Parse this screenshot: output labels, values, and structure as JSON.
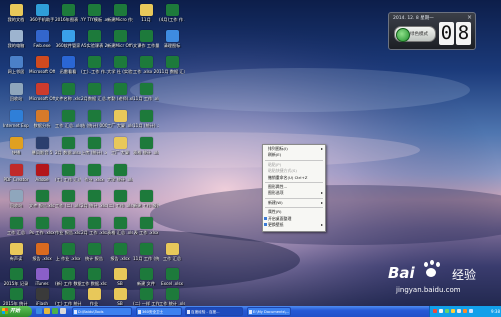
{
  "desktop": {
    "icons": [
      {
        "label": "我的文档",
        "color": "#e8c85a",
        "col": 0,
        "row": 0
      },
      {
        "label": "360手机助手",
        "color": "#2f9ed8",
        "col": 1,
        "row": 0
      },
      {
        "label": "2016年图表 ..xlsx",
        "color": "#1d7a3b",
        "col": 2,
        "row": 0
      },
      {
        "label": "YY TIY模板 .xlsx",
        "color": "#1d7a3b",
        "col": 3,
        "row": 0
      },
      {
        "label": "新建Micro 作业 .xlsx",
        "color": "#1d7a3b",
        "col": 4,
        "row": 0
      },
      {
        "label": "11月",
        "color": "#e8c85a",
        "col": 5,
        "row": 0
      },
      {
        "label": "(4月)工作 作 .xlsx",
        "color": "#1d7a3b",
        "col": 6,
        "row": 0
      },
      {
        "label": "我的电脑",
        "color": "#9db4cf",
        "col": 0,
        "row": 1
      },
      {
        "label": "Fwb.exe",
        "color": "#3366cc",
        "col": 1,
        "row": 1
      },
      {
        "label": "360软件管家",
        "color": "#3aa0e8",
        "col": 2,
        "row": 1
      },
      {
        "label": "A5实验课表 2016.xlsx",
        "color": "#1d7a3b",
        "col": 3,
        "row": 1
      },
      {
        "label": "新建Micr Office..",
        "color": "#1d7a3b",
        "col": 4,
        "row": 1
      },
      {
        "label": "文课作 工作量 .xlsx",
        "color": "#1d7a3b",
        "col": 5,
        "row": 1
      },
      {
        "label": "清理图标",
        "color": "#3e8be0",
        "col": 6,
        "row": 1
      },
      {
        "label": "网上邻居",
        "color": "#4b80c8",
        "col": 0,
        "row": 2
      },
      {
        "label": "Microsoft Office..",
        "color": "#d04a1f",
        "col": 1,
        "row": 2
      },
      {
        "label": "迅雷看看",
        "color": "#2a66d4",
        "col": 2,
        "row": 2
      },
      {
        "label": "(工)..工作 作.xlsx",
        "color": "#1d7a3b",
        "col": 3,
        "row": 2
      },
      {
        "label": "大学 社 (实验报告) .xlsx",
        "color": "#1d7a3b",
        "col": 4,
        "row": 2
      },
      {
        "label": "工作 .xlsx 2015年",
        "color": "#1d7a3b",
        "col": 5,
        "row": 2
      },
      {
        "label": "11月 数据 汇总..xlsx",
        "color": "#1d7a3b",
        "col": 6,
        "row": 2
      },
      {
        "label": "回收站",
        "color": "#8fa6bc",
        "col": 0,
        "row": 3
      },
      {
        "label": "Microsoft Office..",
        "color": "#cc3b2c",
        "col": 1,
        "row": 3
      },
      {
        "label": "文件名称 .xlsx",
        "color": "#1d7a3b",
        "col": 2,
        "row": 3
      },
      {
        "label": "2月数据 汇总.xlsx",
        "color": "#1d7a3b",
        "col": 3,
        "row": 3
      },
      {
        "label": "考勤 (老师).xlsx",
        "color": "#1d7a3b",
        "col": 4,
        "row": 3
      },
      {
        "label": "11月 工作 .xlsx",
        "color": "#1d7a3b",
        "col": 5,
        "row": 3
      },
      {
        "label": "Internet Explorer",
        "color": "#2f7fd8",
        "col": 0,
        "row": 4
      },
      {
        "label": "数据分析",
        "color": "#d67a2a",
        "col": 1,
        "row": 4
      },
      {
        "label": "工作 汇总..xlsx",
        "color": "#1d7a3b",
        "col": 2,
        "row": 4
      },
      {
        "label": "结 (统计) 0000.xlsx",
        "color": "#1d7a3b",
        "col": 3,
        "row": 4
      },
      {
        "label": "工厂 大厦 .xlsx",
        "color": "#e8c85a",
        "col": 4,
        "row": 4
      },
      {
        "label": "11月 (统计) .xlsx",
        "color": "#1d7a3b",
        "col": 5,
        "row": 4
      },
      {
        "label": "快播",
        "color": "#e0a020",
        "col": 0,
        "row": 5
      },
      {
        "label": "暴风影音 5",
        "color": "#2b3f6e",
        "col": 1,
        "row": 5
      },
      {
        "label": "2月 数据.xlsx",
        "color": "#1d7a3b",
        "col": 2,
        "row": 5
      },
      {
        "label": "上传 (统计) .xlsx",
        "color": "#1d7a3b",
        "col": 3,
        "row": 5
      },
      {
        "label": "工厂 大厦",
        "color": "#e8c85a",
        "col": 4,
        "row": 5
      },
      {
        "label": "表格 统计 .xlsx",
        "color": "#1d7a3b",
        "col": 5,
        "row": 5
      },
      {
        "label": "PDF Creator",
        "color": "#c02a2a",
        "col": 0,
        "row": 6
      },
      {
        "label": "Adobe",
        "color": "#b3161b",
        "col": 1,
        "row": 6
      },
      {
        "label": "(工) 工作 汇总.xlsx",
        "color": "#1d7a3b",
        "col": 2,
        "row": 6
      },
      {
        "label": "作业 .xlsx",
        "color": "#1d7a3b",
        "col": 3,
        "row": 6
      },
      {
        "label": "大学 统计 .xlsx",
        "color": "#1d7a3b",
        "col": 4,
        "row": 6
      },
      {
        "label": "回收站",
        "color": "#8fa6bc",
        "col": 0,
        "row": 7
      },
      {
        "label": "文件 报告.xlsx",
        "color": "#1d7a3b",
        "col": 1,
        "row": 7
      },
      {
        "label": "工作 (二) .xlsx",
        "color": "#1d7a3b",
        "col": 2,
        "row": 7
      },
      {
        "label": "2月 统计 .xlsx",
        "color": "#1d7a3b",
        "col": 3,
        "row": 7
      },
      {
        "label": "(二) 工作 .xlsx",
        "color": "#1d7a3b",
        "col": 4,
        "row": 7
      },
      {
        "label": "新建 工作 报告 表.xlsx",
        "color": "#1d7a3b",
        "col": 5,
        "row": 7
      },
      {
        "label": "工作 汇总",
        "color": "#1d7a3b",
        "col": 0,
        "row": 8
      },
      {
        "label": "Ps 工作 .xlsx",
        "color": "#1d7a3b",
        "col": 1,
        "row": 8
      },
      {
        "label": "作业 报告.xlsx",
        "color": "#1d7a3b",
        "col": 2,
        "row": 8
      },
      {
        "label": "2月 工作 .xlsx",
        "color": "#1d7a3b",
        "col": 3,
        "row": 8
      },
      {
        "label": "表格 汇总 .xlsx",
        "color": "#1d7a3b",
        "col": 4,
        "row": 8
      },
      {
        "label": "表 工作 .xlsx",
        "color": "#1d7a3b",
        "col": 5,
        "row": 8
      },
      {
        "label": "有声读",
        "color": "#e8c85a",
        "col": 0,
        "row": 9
      },
      {
        "label": "报告 .xlsx",
        "color": "#d96a1f",
        "col": 1,
        "row": 9
      },
      {
        "label": "上 作业 .xlsx",
        "color": "#1d7a3b",
        "col": 2,
        "row": 9
      },
      {
        "label": "统计 报告",
        "color": "#1d7a3b",
        "col": 3,
        "row": 9
      },
      {
        "label": "报告 .xlsx",
        "color": "#1d7a3b",
        "col": 4,
        "row": 9
      },
      {
        "label": "11月 工作 (统计).xlsx",
        "color": "#1d7a3b",
        "col": 5,
        "row": 9
      },
      {
        "label": "工作 汇总",
        "color": "#e8c85a",
        "col": 6,
        "row": 9
      },
      {
        "label": "2015年 记录",
        "color": "#1d7a3b",
        "col": 0,
        "row": 10
      },
      {
        "label": "iTunes",
        "color": "#8a5fc8",
        "col": 1,
        "row": 10
      },
      {
        "label": "(新) 工作 数据 表.xlsx",
        "color": "#1d7a3b",
        "col": 2,
        "row": 10
      },
      {
        "label": "工作 数据.xlsx",
        "color": "#1d7a3b",
        "col": 3,
        "row": 10
      },
      {
        "label": "SB",
        "color": "#e8c85a",
        "col": 4,
        "row": 10
      },
      {
        "label": "新建 文件",
        "color": "#1d7a3b",
        "col": 5,
        "row": 10
      },
      {
        "label": "Excel .xlsx",
        "color": "#1d7a3b",
        "col": 6,
        "row": 10
      },
      {
        "label": "2015年 统计 报告",
        "color": "#1d7a3b",
        "col": 0,
        "row": 11
      },
      {
        "label": "iFlash",
        "color": "#3a3a3a",
        "col": 1,
        "row": 11
      },
      {
        "label": "(工) 工作 统计 .xlsx",
        "color": "#1d7a3b",
        "col": 2,
        "row": 11
      },
      {
        "label": "作业",
        "color": "#e8c85a",
        "col": 3,
        "row": 11
      },
      {
        "label": "SB",
        "color": "#e8c85a",
        "col": 4,
        "row": 11
      },
      {
        "label": "(二) 一样 工作",
        "color": "#1d7a3b",
        "col": 5,
        "row": 11
      },
      {
        "label": "工作 统计 .xlsx",
        "color": "#1d7a3b",
        "col": 6,
        "row": 11
      }
    ]
  },
  "gadget": {
    "date": "2014. 12. 8 星期一",
    "close": "×",
    "status": "绿色模式",
    "digit1": "0",
    "digit2": "8"
  },
  "context_menu": {
    "items": [
      {
        "label": "排列图标(I)",
        "submenu": true,
        "disabled": false,
        "icon": false,
        "sep_after": false
      },
      {
        "label": "刷新(E)",
        "submenu": false,
        "disabled": false,
        "icon": false,
        "sep_after": true
      },
      {
        "label": "粘贴(P)",
        "submenu": false,
        "disabled": true,
        "icon": false,
        "sep_after": false
      },
      {
        "label": "粘贴快捷方式(S)",
        "submenu": false,
        "disabled": true,
        "icon": false,
        "sep_after": false
      },
      {
        "label": "撤销重命名(U)  Ctrl+Z",
        "submenu": false,
        "disabled": false,
        "icon": false,
        "sep_after": true
      },
      {
        "label": "图形属性...",
        "submenu": false,
        "disabled": false,
        "icon": false,
        "sep_after": false
      },
      {
        "label": "图形选项",
        "submenu": true,
        "disabled": false,
        "icon": false,
        "sep_after": true
      },
      {
        "label": "新建(W)",
        "submenu": true,
        "disabled": false,
        "icon": false,
        "sep_after": true
      },
      {
        "label": "属性(R)",
        "submenu": false,
        "disabled": false,
        "icon": false,
        "sep_after": false
      },
      {
        "label": "开启桌面整理",
        "submenu": false,
        "disabled": false,
        "icon": true,
        "sep_after": false
      },
      {
        "label": "更换壁纸",
        "submenu": true,
        "disabled": false,
        "icon": true,
        "sep_after": false
      }
    ]
  },
  "taskbar": {
    "start_label": "开始",
    "tasks": [
      {
        "label": "D:\\Baidu\\Tools",
        "active": false
      },
      {
        "label": "360安全卫士",
        "active": false
      },
      {
        "label": "百度经验 - 百度...",
        "active": true
      },
      {
        "label": "E:\\My Documents\\...",
        "active": false
      }
    ],
    "clock": "9:38"
  },
  "watermark": {
    "logo": "Bai",
    "logo2": "百",
    "cn": "经验",
    "url": "jingyan.baidu.com"
  }
}
